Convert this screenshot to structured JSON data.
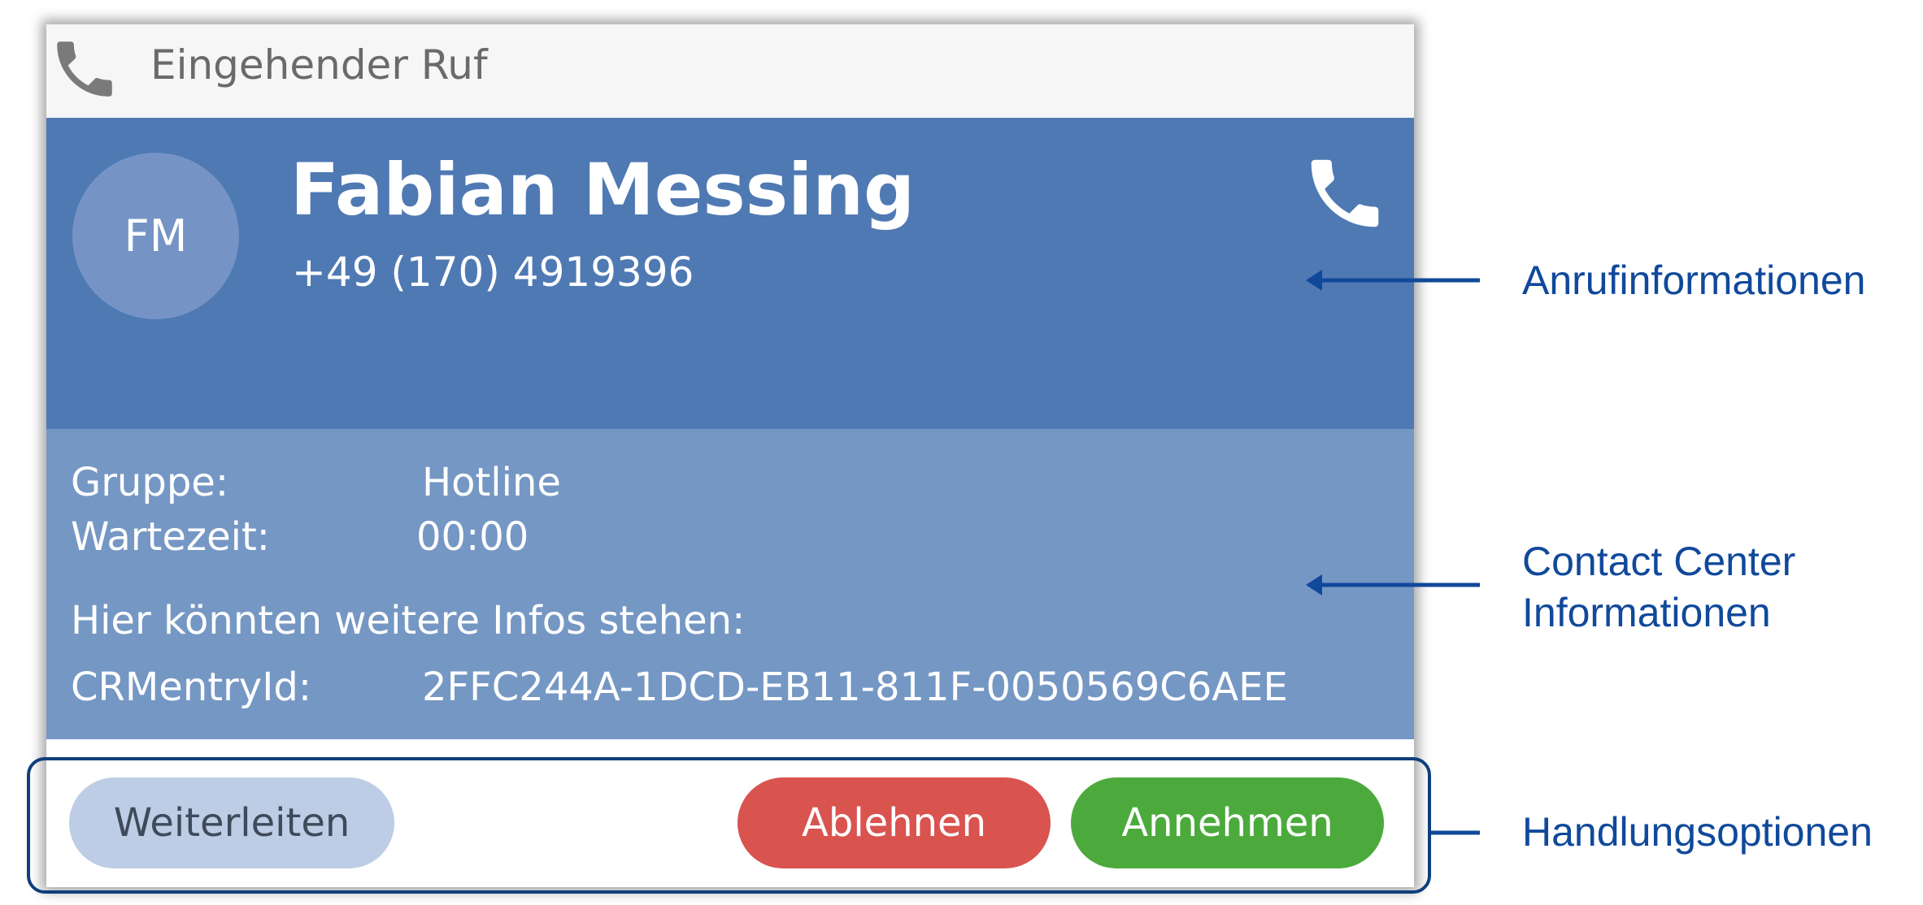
{
  "window": {
    "title": "Eingehender Ruf",
    "title_icon": "phone-icon"
  },
  "caller": {
    "initials": "FM",
    "name": "Fabian Messing",
    "number": "+49 (170) 4919396",
    "call_icon": "phone-ringing-icon"
  },
  "contact_center": {
    "group_label": "Gruppe:",
    "group_value": "Hotline",
    "wait_label": "Wartezeit:",
    "wait_value": "00:00",
    "info_text": "Hier könnten weitere Infos stehen:",
    "crm_label": "CRMentryId:",
    "crm_value": "2FFC244A-1DCD-EB11-811F-0050569C6AEE"
  },
  "actions": {
    "forward_label": "Weiterleiten",
    "decline_label": "Ablehnen",
    "accept_label": "Annehmen"
  },
  "annotations": {
    "call_info": "Anrufinformationen",
    "contact_center_line1": "Contact Center",
    "contact_center_line2": "Informationen",
    "options": "Handlungsoptionen"
  },
  "colors": {
    "caller_panel": "#4f79b3",
    "contact_center_panel": "#7597c4",
    "decline": "#d9534f",
    "accept": "#4caa3d",
    "forward": "#bdcde5",
    "annotation": "#10499b"
  }
}
